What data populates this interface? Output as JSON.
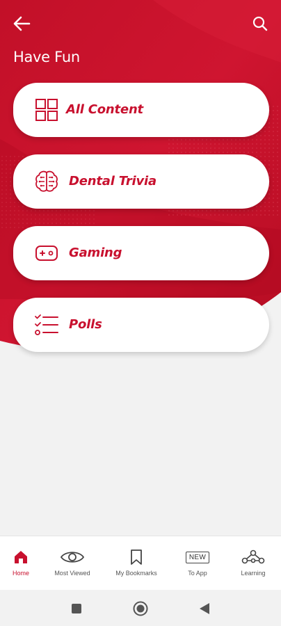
{
  "header": {
    "back_icon": "arrow-left-icon",
    "search_icon": "search-icon",
    "title": "Have Fun"
  },
  "colors": {
    "brand_red": "#c8102e",
    "hero_red_dark": "#b80d24",
    "hero_red_light": "#d41a33",
    "card_bg": "#ffffff",
    "page_bg": "#f2f2f2"
  },
  "cards": [
    {
      "label": "All Content",
      "icon": "grid-icon"
    },
    {
      "label": "Dental Trivia",
      "icon": "brain-icon"
    },
    {
      "label": "Gaming",
      "icon": "gamepad-icon"
    },
    {
      "label": "Polls",
      "icon": "checklist-icon"
    }
  ],
  "bottom_nav": {
    "items": [
      {
        "label": "Home",
        "icon": "home-icon",
        "active": true
      },
      {
        "label": "Most Viewed",
        "icon": "eye-icon",
        "active": false
      },
      {
        "label": "My Bookmarks",
        "icon": "bookmark-icon",
        "active": false
      },
      {
        "label": "To App",
        "icon": "new-badge-icon",
        "badge": "NEW",
        "active": false
      },
      {
        "label": "Learning",
        "icon": "learning-path-icon",
        "active": false
      }
    ]
  },
  "system_nav": {
    "buttons": [
      "recent-apps-icon",
      "home-circle-icon",
      "back-triangle-icon"
    ]
  }
}
